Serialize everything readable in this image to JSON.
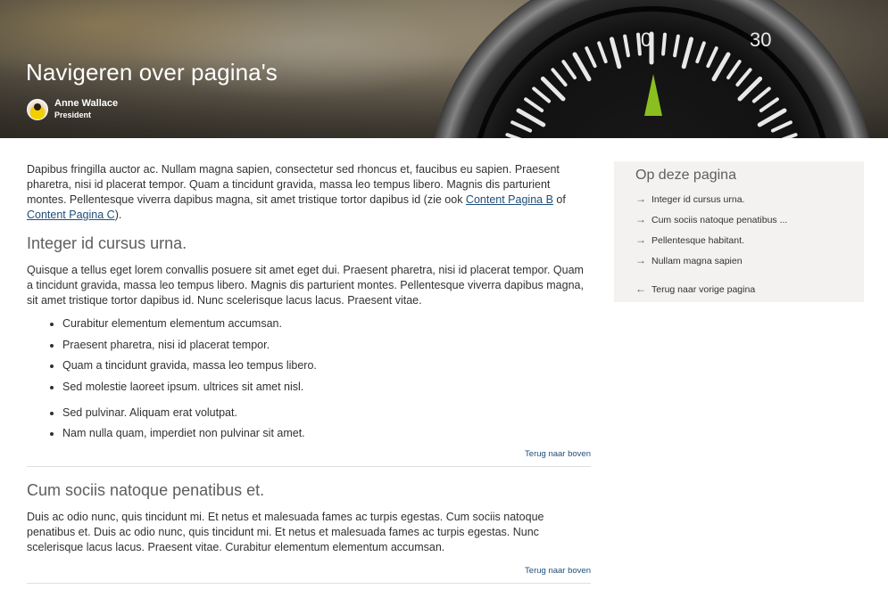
{
  "hero": {
    "title": "Navigeren over pagina's",
    "author": {
      "name": "Anne Wallace",
      "role": "President"
    },
    "compass_numbers": [
      "0",
      "30"
    ]
  },
  "content": {
    "intro": {
      "text_before": "Dapibus fringilla auctor ac. Nullam magna sapien, consectetur sed rhoncus et, faucibus eu sapien. Praesent pharetra, nisi id placerat tempor. Quam a tincidunt gravida, massa leo tempus libero. Magnis dis parturient montes. Pellentesque viverra dapibus magna, sit amet tristique tortor dapibus id (zie ook ",
      "link1": "Content Pagina B",
      "text_between": " of ",
      "link2": "Content Pagina C",
      "text_after": ")."
    },
    "section1": {
      "heading": "Integer id cursus urna.",
      "paragraph": "Quisque a tellus eget lorem convallis posuere sit amet eget dui. Praesent pharetra, nisi id placerat tempor. Quam a tincidunt gravida, massa leo tempus libero. Magnis dis parturient montes. Pellentesque viverra dapibus magna, sit amet tristique tortor dapibus id. Nunc scelerisque lacus lacus. Praesent vitae.",
      "bullets": [
        "Curabitur elementum elementum accumsan.",
        "Praesent pharetra, nisi id placerat tempor.",
        "Quam a tincidunt gravida, massa leo tempus libero.",
        "Sed molestie laoreet ipsum. ultrices sit amet nisl.",
        "Sed pulvinar. Aliquam erat volutpat.",
        "Nam nulla quam, imperdiet non pulvinar sit amet."
      ],
      "back_to_top": "Terug naar boven"
    },
    "section2": {
      "heading": "Cum sociis natoque penatibus et.",
      "paragraph": "Duis ac odio nunc, quis tincidunt mi. Et netus et malesuada fames ac turpis egestas. Cum sociis natoque penatibus et. Duis ac odio nunc, quis tincidunt mi. Et netus et malesuada fames ac turpis egestas. Nunc scelerisque lacus lacus. Praesent vitae. Curabitur elementum elementum accumsan.",
      "back_to_top": "Terug naar boven"
    }
  },
  "toc": {
    "title": "Op deze pagina",
    "items": [
      "Integer id cursus urna.",
      "Cum sociis natoque penatibus ...",
      "Pellentesque habitant.",
      "Nullam magna sapien"
    ],
    "back": "Terug naar vorige pagina",
    "icons": {
      "item": "arrow-right-icon",
      "back": "arrow-left-icon"
    }
  }
}
